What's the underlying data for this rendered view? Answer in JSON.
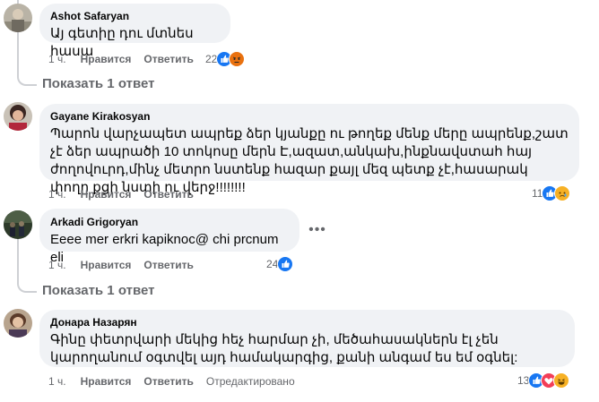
{
  "comments": [
    {
      "author": "Ashot Safaryan",
      "text": "Այ գետիը դու մտնես հասա",
      "time": "1 ч.",
      "like_label": "Нравится",
      "reply_label": "Ответить",
      "reaction_count": "22",
      "reactions": [
        "like-icon",
        "angry-icon"
      ]
    },
    {
      "author": "Gayane Kirakosyan",
      "text": "Պարոն վարչապետ ապրեք ձեր կյանքը ու թողեք մենք մերը ապրենք,շատ չէ ձեր ապրածի 10 տոկոսը մերն Է,ազատ,անկախ,ինքնավստահ հայ ժողովուրդ,մինչ մետրո նստենք հազար քայլ մեզ պետք չէ,հասարակ փողը քցի նստի ու վերջ!!!!!!!!",
      "time": "1 ч.",
      "like_label": "Нравится",
      "reply_label": "Ответить",
      "reaction_count": "11",
      "reactions": [
        "like-icon",
        "sad-icon"
      ]
    },
    {
      "author": "Arkadi Grigoryan",
      "text": "Eeee mer erkri kapiknoc@ chi prcnum eli",
      "time": "1 ч.",
      "like_label": "Нравится",
      "reply_label": "Ответить",
      "reaction_count": "24",
      "reactions": [
        "like-icon"
      ]
    },
    {
      "author": "Донара Назарян",
      "text": "Գինը փետրվարի մեկից հեչ հարմար չի, մեծահասակներն էլ չեն կարողանում օգտվել այդ համակարգից, քանի անգամ ես եմ օգնել:",
      "time": "1 ч.",
      "like_label": "Нравится",
      "reply_label": "Ответить",
      "edited_label": "Отредактировано",
      "reaction_count": "13",
      "reactions": [
        "like-icon",
        "love-icon",
        "haha-icon"
      ]
    }
  ],
  "show_replies": [
    {
      "label": "Показать 1 ответ"
    },
    {
      "label": "Показать 1 ответ"
    }
  ],
  "more_options_glyph": "•••",
  "colors": {
    "bubble_bg": "#f0f2f5",
    "meta_text": "#65676b",
    "like_blue": "#1877f2",
    "angry_red": "#e9710f",
    "sad_yellow": "#f7b125",
    "love_red": "#f33e58"
  }
}
